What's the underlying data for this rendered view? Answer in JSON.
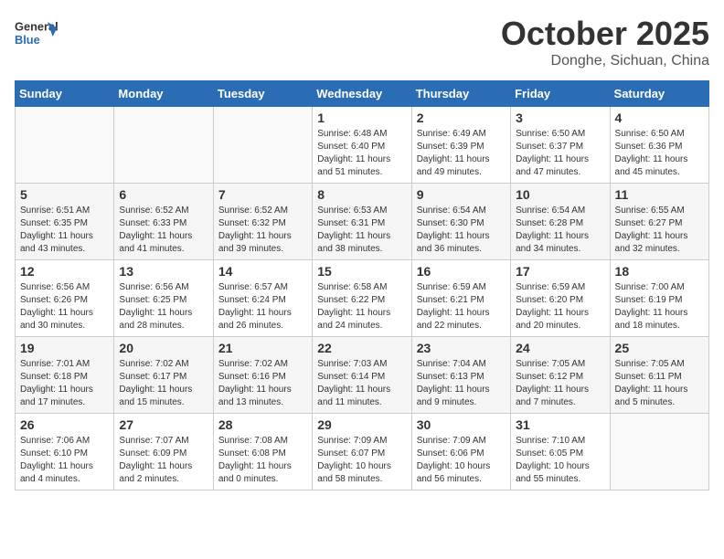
{
  "header": {
    "logo_general": "General",
    "logo_blue": "Blue",
    "month_title": "October 2025",
    "location": "Donghe, Sichuan, China"
  },
  "weekdays": [
    "Sunday",
    "Monday",
    "Tuesday",
    "Wednesday",
    "Thursday",
    "Friday",
    "Saturday"
  ],
  "weeks": [
    [
      {
        "day": "",
        "info": ""
      },
      {
        "day": "",
        "info": ""
      },
      {
        "day": "",
        "info": ""
      },
      {
        "day": "1",
        "info": "Sunrise: 6:48 AM\nSunset: 6:40 PM\nDaylight: 11 hours and 51 minutes."
      },
      {
        "day": "2",
        "info": "Sunrise: 6:49 AM\nSunset: 6:39 PM\nDaylight: 11 hours and 49 minutes."
      },
      {
        "day": "3",
        "info": "Sunrise: 6:50 AM\nSunset: 6:37 PM\nDaylight: 11 hours and 47 minutes."
      },
      {
        "day": "4",
        "info": "Sunrise: 6:50 AM\nSunset: 6:36 PM\nDaylight: 11 hours and 45 minutes."
      }
    ],
    [
      {
        "day": "5",
        "info": "Sunrise: 6:51 AM\nSunset: 6:35 PM\nDaylight: 11 hours and 43 minutes."
      },
      {
        "day": "6",
        "info": "Sunrise: 6:52 AM\nSunset: 6:33 PM\nDaylight: 11 hours and 41 minutes."
      },
      {
        "day": "7",
        "info": "Sunrise: 6:52 AM\nSunset: 6:32 PM\nDaylight: 11 hours and 39 minutes."
      },
      {
        "day": "8",
        "info": "Sunrise: 6:53 AM\nSunset: 6:31 PM\nDaylight: 11 hours and 38 minutes."
      },
      {
        "day": "9",
        "info": "Sunrise: 6:54 AM\nSunset: 6:30 PM\nDaylight: 11 hours and 36 minutes."
      },
      {
        "day": "10",
        "info": "Sunrise: 6:54 AM\nSunset: 6:28 PM\nDaylight: 11 hours and 34 minutes."
      },
      {
        "day": "11",
        "info": "Sunrise: 6:55 AM\nSunset: 6:27 PM\nDaylight: 11 hours and 32 minutes."
      }
    ],
    [
      {
        "day": "12",
        "info": "Sunrise: 6:56 AM\nSunset: 6:26 PM\nDaylight: 11 hours and 30 minutes."
      },
      {
        "day": "13",
        "info": "Sunrise: 6:56 AM\nSunset: 6:25 PM\nDaylight: 11 hours and 28 minutes."
      },
      {
        "day": "14",
        "info": "Sunrise: 6:57 AM\nSunset: 6:24 PM\nDaylight: 11 hours and 26 minutes."
      },
      {
        "day": "15",
        "info": "Sunrise: 6:58 AM\nSunset: 6:22 PM\nDaylight: 11 hours and 24 minutes."
      },
      {
        "day": "16",
        "info": "Sunrise: 6:59 AM\nSunset: 6:21 PM\nDaylight: 11 hours and 22 minutes."
      },
      {
        "day": "17",
        "info": "Sunrise: 6:59 AM\nSunset: 6:20 PM\nDaylight: 11 hours and 20 minutes."
      },
      {
        "day": "18",
        "info": "Sunrise: 7:00 AM\nSunset: 6:19 PM\nDaylight: 11 hours and 18 minutes."
      }
    ],
    [
      {
        "day": "19",
        "info": "Sunrise: 7:01 AM\nSunset: 6:18 PM\nDaylight: 11 hours and 17 minutes."
      },
      {
        "day": "20",
        "info": "Sunrise: 7:02 AM\nSunset: 6:17 PM\nDaylight: 11 hours and 15 minutes."
      },
      {
        "day": "21",
        "info": "Sunrise: 7:02 AM\nSunset: 6:16 PM\nDaylight: 11 hours and 13 minutes."
      },
      {
        "day": "22",
        "info": "Sunrise: 7:03 AM\nSunset: 6:14 PM\nDaylight: 11 hours and 11 minutes."
      },
      {
        "day": "23",
        "info": "Sunrise: 7:04 AM\nSunset: 6:13 PM\nDaylight: 11 hours and 9 minutes."
      },
      {
        "day": "24",
        "info": "Sunrise: 7:05 AM\nSunset: 6:12 PM\nDaylight: 11 hours and 7 minutes."
      },
      {
        "day": "25",
        "info": "Sunrise: 7:05 AM\nSunset: 6:11 PM\nDaylight: 11 hours and 5 minutes."
      }
    ],
    [
      {
        "day": "26",
        "info": "Sunrise: 7:06 AM\nSunset: 6:10 PM\nDaylight: 11 hours and 4 minutes."
      },
      {
        "day": "27",
        "info": "Sunrise: 7:07 AM\nSunset: 6:09 PM\nDaylight: 11 hours and 2 minutes."
      },
      {
        "day": "28",
        "info": "Sunrise: 7:08 AM\nSunset: 6:08 PM\nDaylight: 11 hours and 0 minutes."
      },
      {
        "day": "29",
        "info": "Sunrise: 7:09 AM\nSunset: 6:07 PM\nDaylight: 10 hours and 58 minutes."
      },
      {
        "day": "30",
        "info": "Sunrise: 7:09 AM\nSunset: 6:06 PM\nDaylight: 10 hours and 56 minutes."
      },
      {
        "day": "31",
        "info": "Sunrise: 7:10 AM\nSunset: 6:05 PM\nDaylight: 10 hours and 55 minutes."
      },
      {
        "day": "",
        "info": ""
      }
    ]
  ]
}
